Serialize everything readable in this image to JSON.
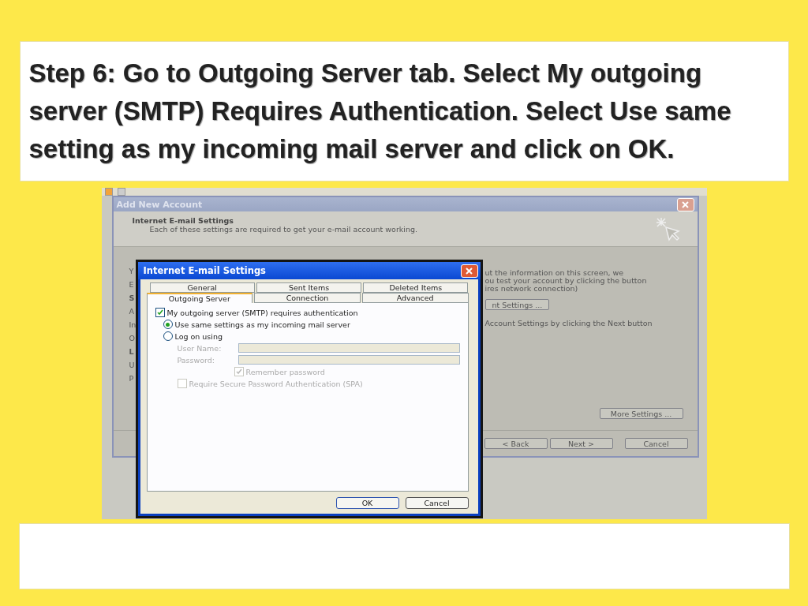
{
  "slide_title": "Step 6: Go to  Outgoing Server tab. Select  My outgoing server (SMTP) Requires Authentication. Select Use same setting as my incoming mail server and click on OK.",
  "back_window": {
    "title": "Add New Account",
    "header_title": "Internet E-mail Settings",
    "header_subtitle": "Each of these settings are required to get your e-mail account working.",
    "left_labels": [
      "Y",
      "E",
      "S",
      "A",
      "In",
      "O",
      "L",
      "U",
      "P"
    ],
    "right_lines": [
      "ut the information on this screen, we",
      "ou test your account by clicking the button",
      "ires network connection)"
    ],
    "test_button": "nt Settings ...",
    "next_hint": "Account Settings by clicking the Next button",
    "more_settings_button": "More Settings ...",
    "buttons": [
      "< Back",
      "Next >",
      "Cancel"
    ]
  },
  "dialog": {
    "title": "Internet E-mail Settings",
    "tab_rows": [
      [
        {
          "label": "General",
          "selected": false
        },
        {
          "label": "Sent Items",
          "selected": false
        },
        {
          "label": "Deleted Items",
          "selected": false
        }
      ],
      [
        {
          "label": "Outgoing Server",
          "selected": true
        },
        {
          "label": "Connection",
          "selected": false
        },
        {
          "label": "Advanced",
          "selected": false
        }
      ]
    ],
    "auth_checkbox": {
      "label": "My outgoing server (SMTP) requires authentication",
      "checked": true
    },
    "radios": [
      {
        "label": "Use same settings as my incoming mail server",
        "selected": true
      },
      {
        "label": "Log on using",
        "selected": false
      }
    ],
    "fields": [
      {
        "label": "User Name:",
        "disabled": true
      },
      {
        "label": "Password:",
        "disabled": true
      }
    ],
    "remember": {
      "label": "Remember password",
      "checked": true,
      "disabled": true
    },
    "spa": {
      "label": "Require Secure Password Authentication (SPA)",
      "checked": false,
      "disabled": true
    },
    "buttons": [
      "OK",
      "Cancel"
    ]
  }
}
